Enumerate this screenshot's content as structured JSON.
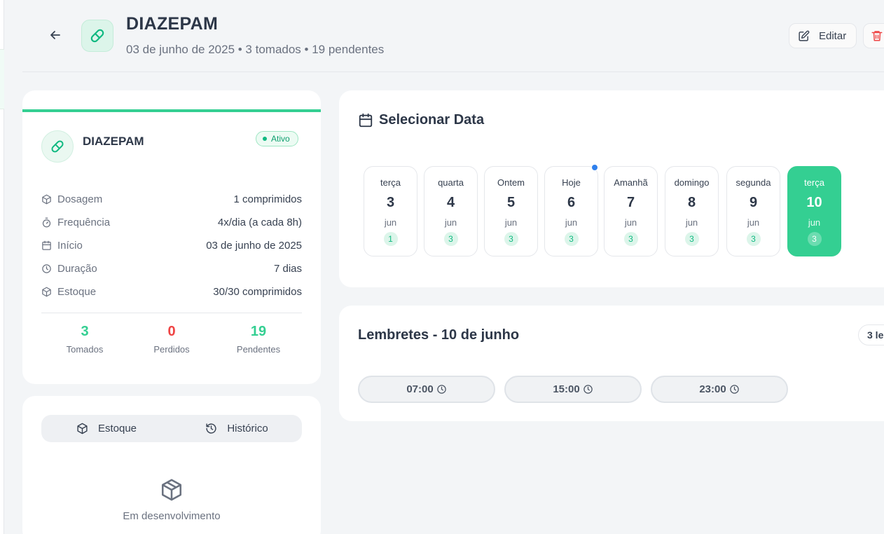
{
  "header": {
    "title": "DIAZEPAM",
    "subtitle": "03 de junho de 2025 • 3 tomados • 19 pendentes",
    "edit_label": "Editar"
  },
  "info": {
    "name": "DIAZEPAM",
    "status": "Ativo",
    "rows": [
      {
        "label": "Dosagem",
        "value": "1 comprimidos",
        "icon": "box-icon"
      },
      {
        "label": "Frequência",
        "value": "4x/dia (a cada 8h)",
        "icon": "timer-icon"
      },
      {
        "label": "Início",
        "value": "03 de junho de 2025",
        "icon": "calendar-icon"
      },
      {
        "label": "Duração",
        "value": "7 dias",
        "icon": "clock-icon"
      },
      {
        "label": "Estoque",
        "value": "30/30 comprimidos",
        "icon": "box-icon"
      }
    ],
    "stats": [
      {
        "num": "3",
        "label": "Tomados",
        "color": "#34cf92"
      },
      {
        "num": "0",
        "label": "Perdidos",
        "color": "#ef4444"
      },
      {
        "num": "19",
        "label": "Pendentes",
        "color": "#34cf92"
      }
    ]
  },
  "tabs": {
    "stock_label": "Estoque",
    "history_label": "Histórico",
    "empty_text": "Em desenvolvimento"
  },
  "date_picker": {
    "title": "Selecionar Data",
    "days": [
      {
        "name": "terça",
        "num": "3",
        "month": "jun",
        "count": "1"
      },
      {
        "name": "quarta",
        "num": "4",
        "month": "jun",
        "count": "3"
      },
      {
        "name": "Ontem",
        "num": "5",
        "month": "jun",
        "count": "3"
      },
      {
        "name": "Hoje",
        "num": "6",
        "month": "jun",
        "count": "3"
      },
      {
        "name": "Amanhã",
        "num": "7",
        "month": "jun",
        "count": "3"
      },
      {
        "name": "domingo",
        "num": "8",
        "month": "jun",
        "count": "3"
      },
      {
        "name": "segunda",
        "num": "9",
        "month": "jun",
        "count": "3"
      },
      {
        "name": "terça",
        "num": "10",
        "month": "jun",
        "count": "3"
      }
    ]
  },
  "reminders": {
    "title": "Lembretes - 10 de junho",
    "badge": "3 le",
    "times": [
      "07:00",
      "15:00",
      "23:00"
    ]
  },
  "colors": {
    "accent": "#34cf92",
    "danger": "#ef4444",
    "today_dot": "#2f80ed"
  }
}
